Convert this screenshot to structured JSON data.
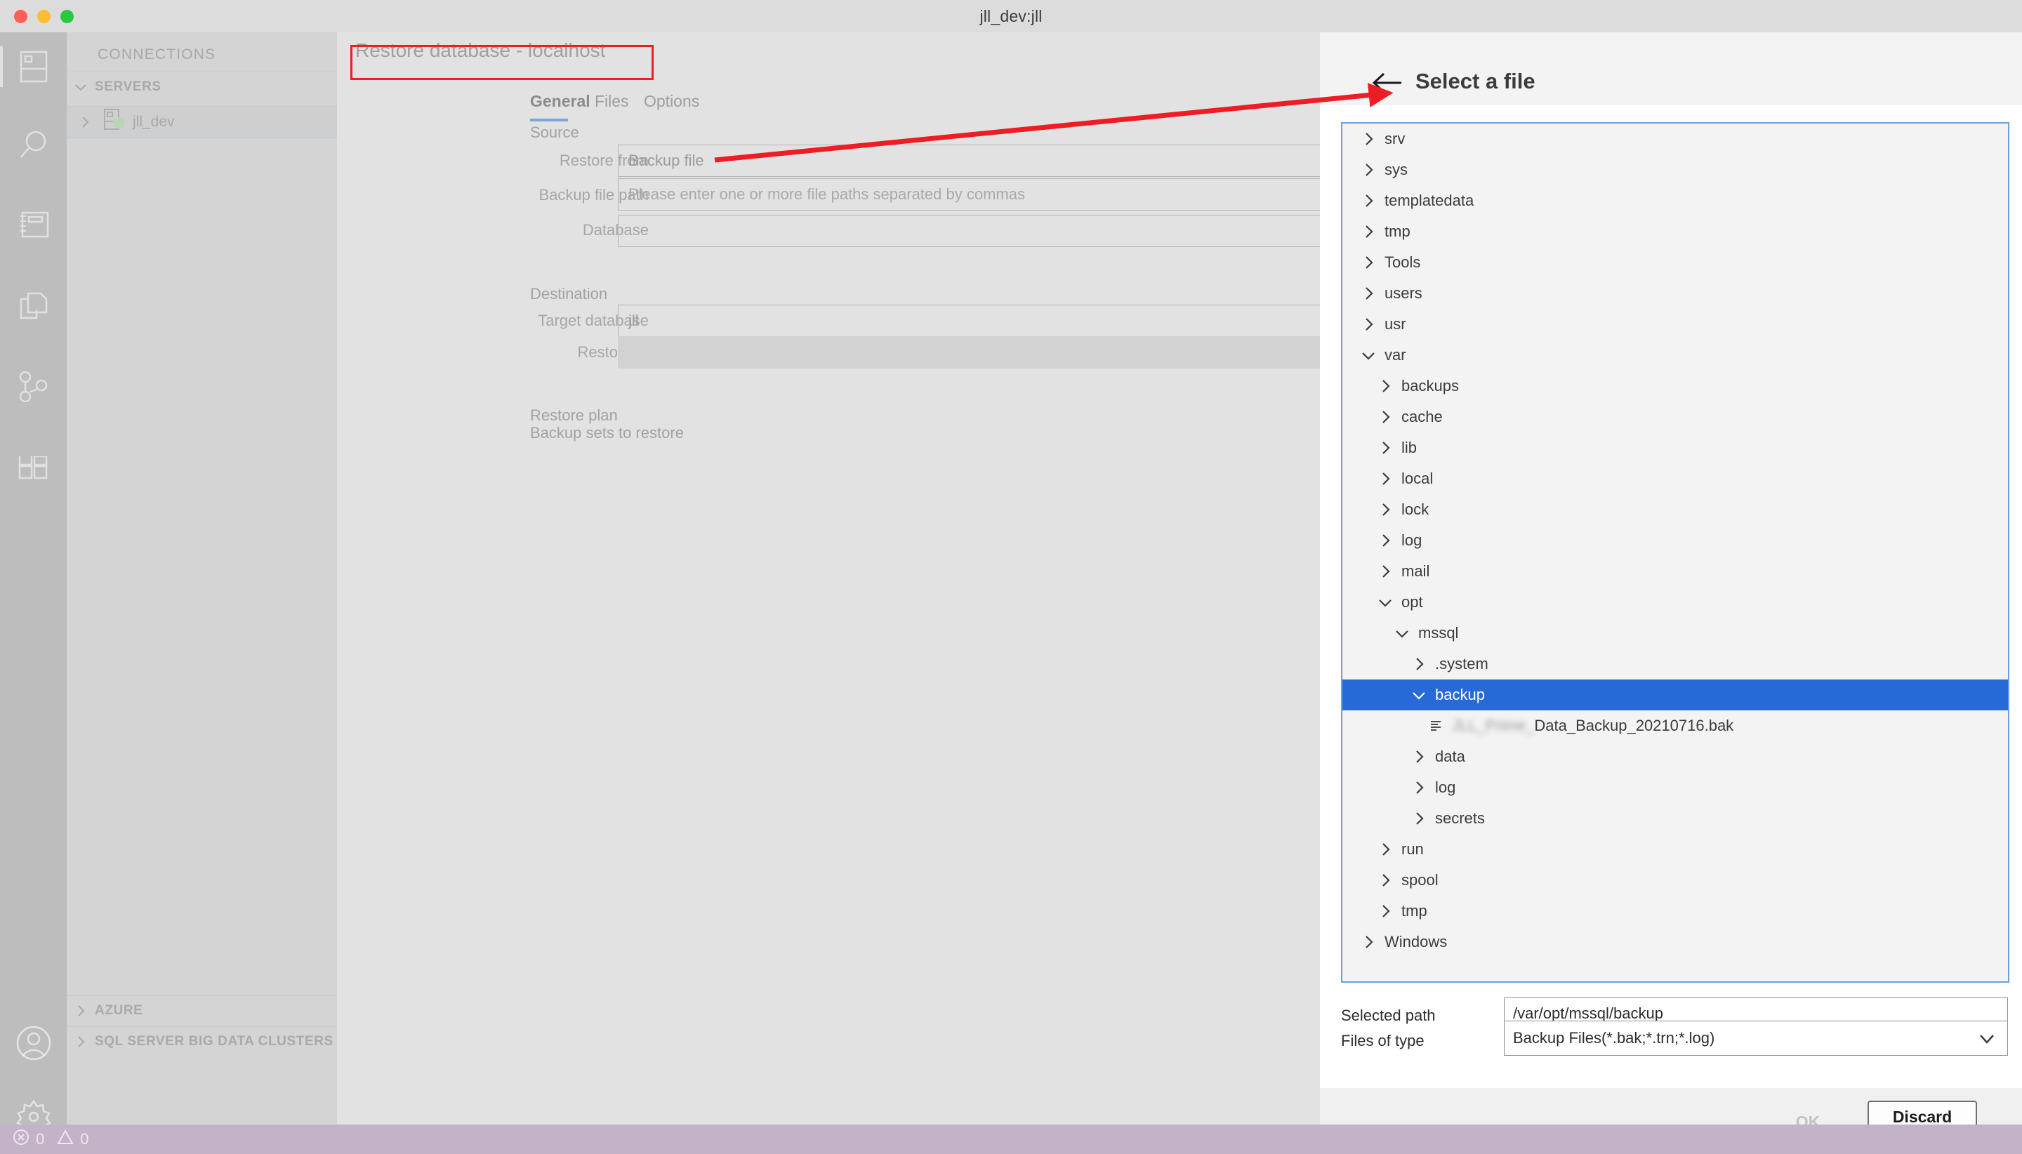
{
  "window": {
    "title": "jll_dev:jll",
    "traffic_lights": [
      "close",
      "minimize",
      "zoom"
    ]
  },
  "activity_bar": {
    "items": [
      {
        "name": "servers-icon",
        "label": "Servers"
      },
      {
        "name": "search-icon",
        "label": "Search"
      },
      {
        "name": "notebooks-icon",
        "label": "Notebooks"
      },
      {
        "name": "data-explorer-icon",
        "label": "Data Explorer"
      },
      {
        "name": "source-control-icon",
        "label": "Source Control"
      },
      {
        "name": "extensions-icon",
        "label": "Extensions"
      }
    ],
    "bottom_items": [
      {
        "name": "account-icon",
        "label": "Accounts"
      },
      {
        "name": "gear-icon",
        "label": "Manage"
      }
    ]
  },
  "sidebar": {
    "title": "CONNECTIONS",
    "sections": [
      {
        "label": "SERVERS",
        "expanded": true
      },
      {
        "label": "AZURE",
        "expanded": false
      },
      {
        "label": "SQL SERVER BIG DATA CLUSTERS",
        "expanded": false
      }
    ],
    "server": {
      "label": "jll_dev",
      "status": "connected"
    }
  },
  "editor": {
    "title": "Restore database - localhost",
    "tabs": [
      {
        "label": "General",
        "active": true
      },
      {
        "label": "Files",
        "active": false
      },
      {
        "label": "Options",
        "active": false
      }
    ],
    "sections": {
      "source": {
        "label": "Source",
        "fields": [
          {
            "label": "Restore from",
            "value": "Backup file",
            "placeholder": ""
          },
          {
            "label": "Backup file path",
            "value": "",
            "placeholder": "Please enter one or more file paths separated by commas"
          },
          {
            "label": "Database",
            "value": "",
            "placeholder": ""
          }
        ]
      },
      "destination": {
        "label": "Destination",
        "fields": [
          {
            "label": "Target database",
            "value": "jll",
            "placeholder": ""
          },
          {
            "label": "Restore to",
            "value": "",
            "placeholder": ""
          }
        ]
      },
      "restore_plan": {
        "label": "Restore plan",
        "subtitle": "Backup sets to restore"
      }
    }
  },
  "file_panel": {
    "title": "Select a file",
    "back_icon": "back-arrow-icon",
    "tree": [
      {
        "label": "srv",
        "depth": 0,
        "state": "collapsed",
        "type": "folder"
      },
      {
        "label": "sys",
        "depth": 0,
        "state": "collapsed",
        "type": "folder"
      },
      {
        "label": "templatedata",
        "depth": 0,
        "state": "collapsed",
        "type": "folder"
      },
      {
        "label": "tmp",
        "depth": 0,
        "state": "collapsed",
        "type": "folder"
      },
      {
        "label": "Tools",
        "depth": 0,
        "state": "collapsed",
        "type": "folder"
      },
      {
        "label": "users",
        "depth": 0,
        "state": "collapsed",
        "type": "folder"
      },
      {
        "label": "usr",
        "depth": 0,
        "state": "collapsed",
        "type": "folder"
      },
      {
        "label": "var",
        "depth": 0,
        "state": "expanded",
        "type": "folder"
      },
      {
        "label": "backups",
        "depth": 1,
        "state": "collapsed",
        "type": "folder"
      },
      {
        "label": "cache",
        "depth": 1,
        "state": "collapsed",
        "type": "folder"
      },
      {
        "label": "lib",
        "depth": 1,
        "state": "collapsed",
        "type": "folder"
      },
      {
        "label": "local",
        "depth": 1,
        "state": "collapsed",
        "type": "folder"
      },
      {
        "label": "lock",
        "depth": 1,
        "state": "collapsed",
        "type": "folder"
      },
      {
        "label": "log",
        "depth": 1,
        "state": "collapsed",
        "type": "folder"
      },
      {
        "label": "mail",
        "depth": 1,
        "state": "collapsed",
        "type": "folder"
      },
      {
        "label": "opt",
        "depth": 1,
        "state": "expanded",
        "type": "folder"
      },
      {
        "label": "mssql",
        "depth": 2,
        "state": "expanded",
        "type": "folder"
      },
      {
        "label": ".system",
        "depth": 3,
        "state": "collapsed",
        "type": "folder"
      },
      {
        "label": "backup",
        "depth": 3,
        "state": "expanded",
        "type": "folder",
        "selected": true
      },
      {
        "label": "Data_Backup_20210716.bak",
        "redacted_prefix": "JLL_Prime_",
        "depth": 4,
        "state": "none",
        "type": "file"
      },
      {
        "label": "data",
        "depth": 3,
        "state": "collapsed",
        "type": "folder"
      },
      {
        "label": "log",
        "depth": 3,
        "state": "collapsed",
        "type": "folder"
      },
      {
        "label": "secrets",
        "depth": 3,
        "state": "collapsed",
        "type": "folder"
      },
      {
        "label": "run",
        "depth": 1,
        "state": "collapsed",
        "type": "folder"
      },
      {
        "label": "spool",
        "depth": 1,
        "state": "collapsed",
        "type": "folder"
      },
      {
        "label": "tmp",
        "depth": 1,
        "state": "collapsed",
        "type": "folder"
      },
      {
        "label": "Windows",
        "depth": 0,
        "state": "collapsed",
        "type": "folder"
      }
    ],
    "selected_path": {
      "label": "Selected path",
      "value": "/var/opt/mssql/backup"
    },
    "files_of_type": {
      "label": "Files of type",
      "value": "Backup Files(*.bak;*.trn;*.log)"
    },
    "buttons": {
      "ok": "OK",
      "discard": "Discard"
    }
  },
  "status_bar": {
    "errors": "0",
    "warnings": "0"
  },
  "colors": {
    "selection_blue": "#2669d7",
    "tab_accent": "#7ba7d7",
    "annotation_red": "#ee1c24",
    "tree_border": "#6ba1dd",
    "status_bar": "#c3b2c8"
  }
}
